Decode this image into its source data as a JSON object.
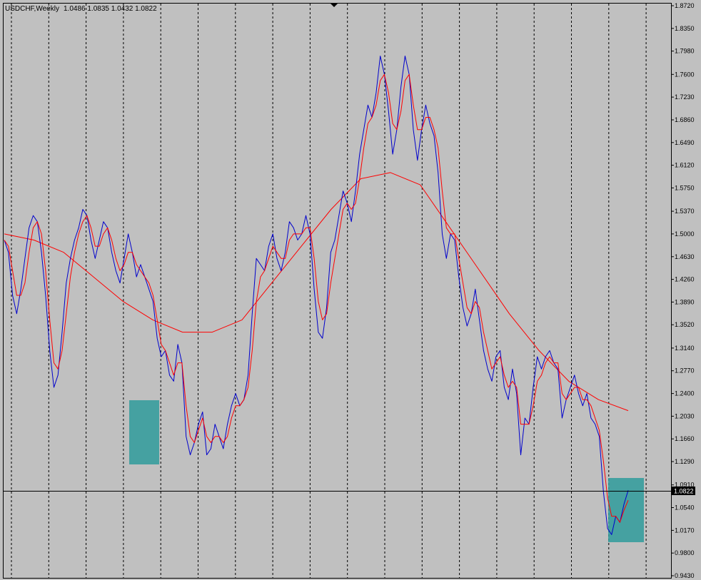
{
  "window": {
    "title": "USDCHF,Weekly",
    "ohlc": "1.0486 1.0835 1.0432 1.0822"
  },
  "colors": {
    "background": "#c0c0c0",
    "price_line": "#0000cc",
    "fast_ma": "#ff0000",
    "slow_ma": "#ff0000",
    "grid": "#000000",
    "highlight_box": "#2f9b9b",
    "current_price_label_bg": "#000000",
    "current_price_label_fg": "#ffffff"
  },
  "chart_data": {
    "type": "line",
    "symbol": "USDCHF",
    "timeframe": "Weekly",
    "xlabel": "",
    "ylabel": "",
    "ylim": [
      0.943,
      1.872
    ],
    "y_ticks": [
      "1.8720",
      "1.8350",
      "1.7980",
      "1.7600",
      "1.7230",
      "1.6860",
      "1.6490",
      "1.6120",
      "1.5750",
      "1.5370",
      "1.5000",
      "1.4630",
      "1.4260",
      "1.3890",
      "1.3520",
      "1.3140",
      "1.2770",
      "1.2400",
      "1.2030",
      "1.1660",
      "1.1290",
      "1.0910",
      "1.0540",
      "1.0170",
      "0.9800",
      "0.9430"
    ],
    "grid": "vertical dashed",
    "current_price": "1.0822",
    "series": [
      {
        "style": "price",
        "values": [
          1.49,
          1.47,
          1.4,
          1.37,
          1.41,
          1.46,
          1.51,
          1.53,
          1.52,
          1.47,
          1.4,
          1.31,
          1.25,
          1.27,
          1.34,
          1.42,
          1.46,
          1.49,
          1.51,
          1.54,
          1.53,
          1.49,
          1.46,
          1.49,
          1.52,
          1.51,
          1.47,
          1.44,
          1.42,
          1.46,
          1.5,
          1.47,
          1.43,
          1.45,
          1.43,
          1.41,
          1.39,
          1.33,
          1.3,
          1.31,
          1.27,
          1.26,
          1.32,
          1.29,
          1.17,
          1.14,
          1.16,
          1.19,
          1.21,
          1.14,
          1.15,
          1.19,
          1.17,
          1.15,
          1.19,
          1.22,
          1.24,
          1.22,
          1.23,
          1.27,
          1.37,
          1.46,
          1.45,
          1.44,
          1.48,
          1.5,
          1.46,
          1.44,
          1.47,
          1.52,
          1.51,
          1.49,
          1.5,
          1.53,
          1.5,
          1.41,
          1.34,
          1.33,
          1.38,
          1.47,
          1.49,
          1.53,
          1.57,
          1.55,
          1.52,
          1.57,
          1.63,
          1.67,
          1.71,
          1.69,
          1.73,
          1.79,
          1.76,
          1.7,
          1.63,
          1.67,
          1.74,
          1.79,
          1.76,
          1.67,
          1.62,
          1.67,
          1.71,
          1.68,
          1.66,
          1.6,
          1.5,
          1.46,
          1.5,
          1.49,
          1.43,
          1.38,
          1.35,
          1.37,
          1.41,
          1.36,
          1.31,
          1.28,
          1.26,
          1.3,
          1.31,
          1.25,
          1.23,
          1.28,
          1.24,
          1.14,
          1.2,
          1.19,
          1.25,
          1.3,
          1.28,
          1.3,
          1.31,
          1.29,
          1.28,
          1.2,
          1.23,
          1.25,
          1.27,
          1.24,
          1.22,
          1.24,
          1.2,
          1.19,
          1.17,
          1.08,
          1.02,
          1.01,
          1.04,
          1.03,
          1.06,
          1.0822
        ]
      },
      {
        "style": "fast_ma",
        "values": [
          1.49,
          1.48,
          1.44,
          1.4,
          1.4,
          1.42,
          1.47,
          1.51,
          1.52,
          1.5,
          1.44,
          1.36,
          1.29,
          1.28,
          1.31,
          1.37,
          1.43,
          1.47,
          1.5,
          1.52,
          1.53,
          1.51,
          1.48,
          1.48,
          1.5,
          1.51,
          1.49,
          1.46,
          1.44,
          1.45,
          1.47,
          1.47,
          1.45,
          1.44,
          1.43,
          1.42,
          1.4,
          1.36,
          1.32,
          1.31,
          1.29,
          1.27,
          1.29,
          1.29,
          1.22,
          1.17,
          1.16,
          1.18,
          1.2,
          1.17,
          1.16,
          1.17,
          1.17,
          1.16,
          1.17,
          1.2,
          1.22,
          1.22,
          1.23,
          1.25,
          1.31,
          1.39,
          1.43,
          1.44,
          1.46,
          1.48,
          1.47,
          1.46,
          1.46,
          1.49,
          1.5,
          1.5,
          1.5,
          1.51,
          1.51,
          1.46,
          1.39,
          1.36,
          1.37,
          1.42,
          1.46,
          1.5,
          1.54,
          1.55,
          1.54,
          1.55,
          1.59,
          1.64,
          1.68,
          1.69,
          1.71,
          1.75,
          1.76,
          1.73,
          1.68,
          1.67,
          1.7,
          1.75,
          1.76,
          1.71,
          1.67,
          1.67,
          1.69,
          1.69,
          1.67,
          1.64,
          1.57,
          1.51,
          1.5,
          1.5,
          1.46,
          1.42,
          1.38,
          1.37,
          1.39,
          1.38,
          1.34,
          1.31,
          1.28,
          1.29,
          1.3,
          1.27,
          1.25,
          1.26,
          1.25,
          1.19,
          1.19,
          1.19,
          1.22,
          1.26,
          1.27,
          1.29,
          1.3,
          1.29,
          1.29,
          1.24,
          1.23,
          1.24,
          1.25,
          1.25,
          1.23,
          1.23,
          1.22,
          1.2,
          1.18,
          1.13,
          1.07,
          1.04,
          1.04,
          1.03,
          1.05,
          1.066
        ]
      },
      {
        "style": "slow_ma",
        "values": [
          1.5,
          1.49,
          1.47,
          1.43,
          1.39,
          1.36,
          1.34,
          1.34,
          1.36,
          1.42,
          1.48,
          1.54,
          1.59,
          1.6,
          1.58,
          1.51,
          1.44,
          1.37,
          1.31,
          1.26,
          1.23,
          1.212
        ]
      }
    ]
  }
}
